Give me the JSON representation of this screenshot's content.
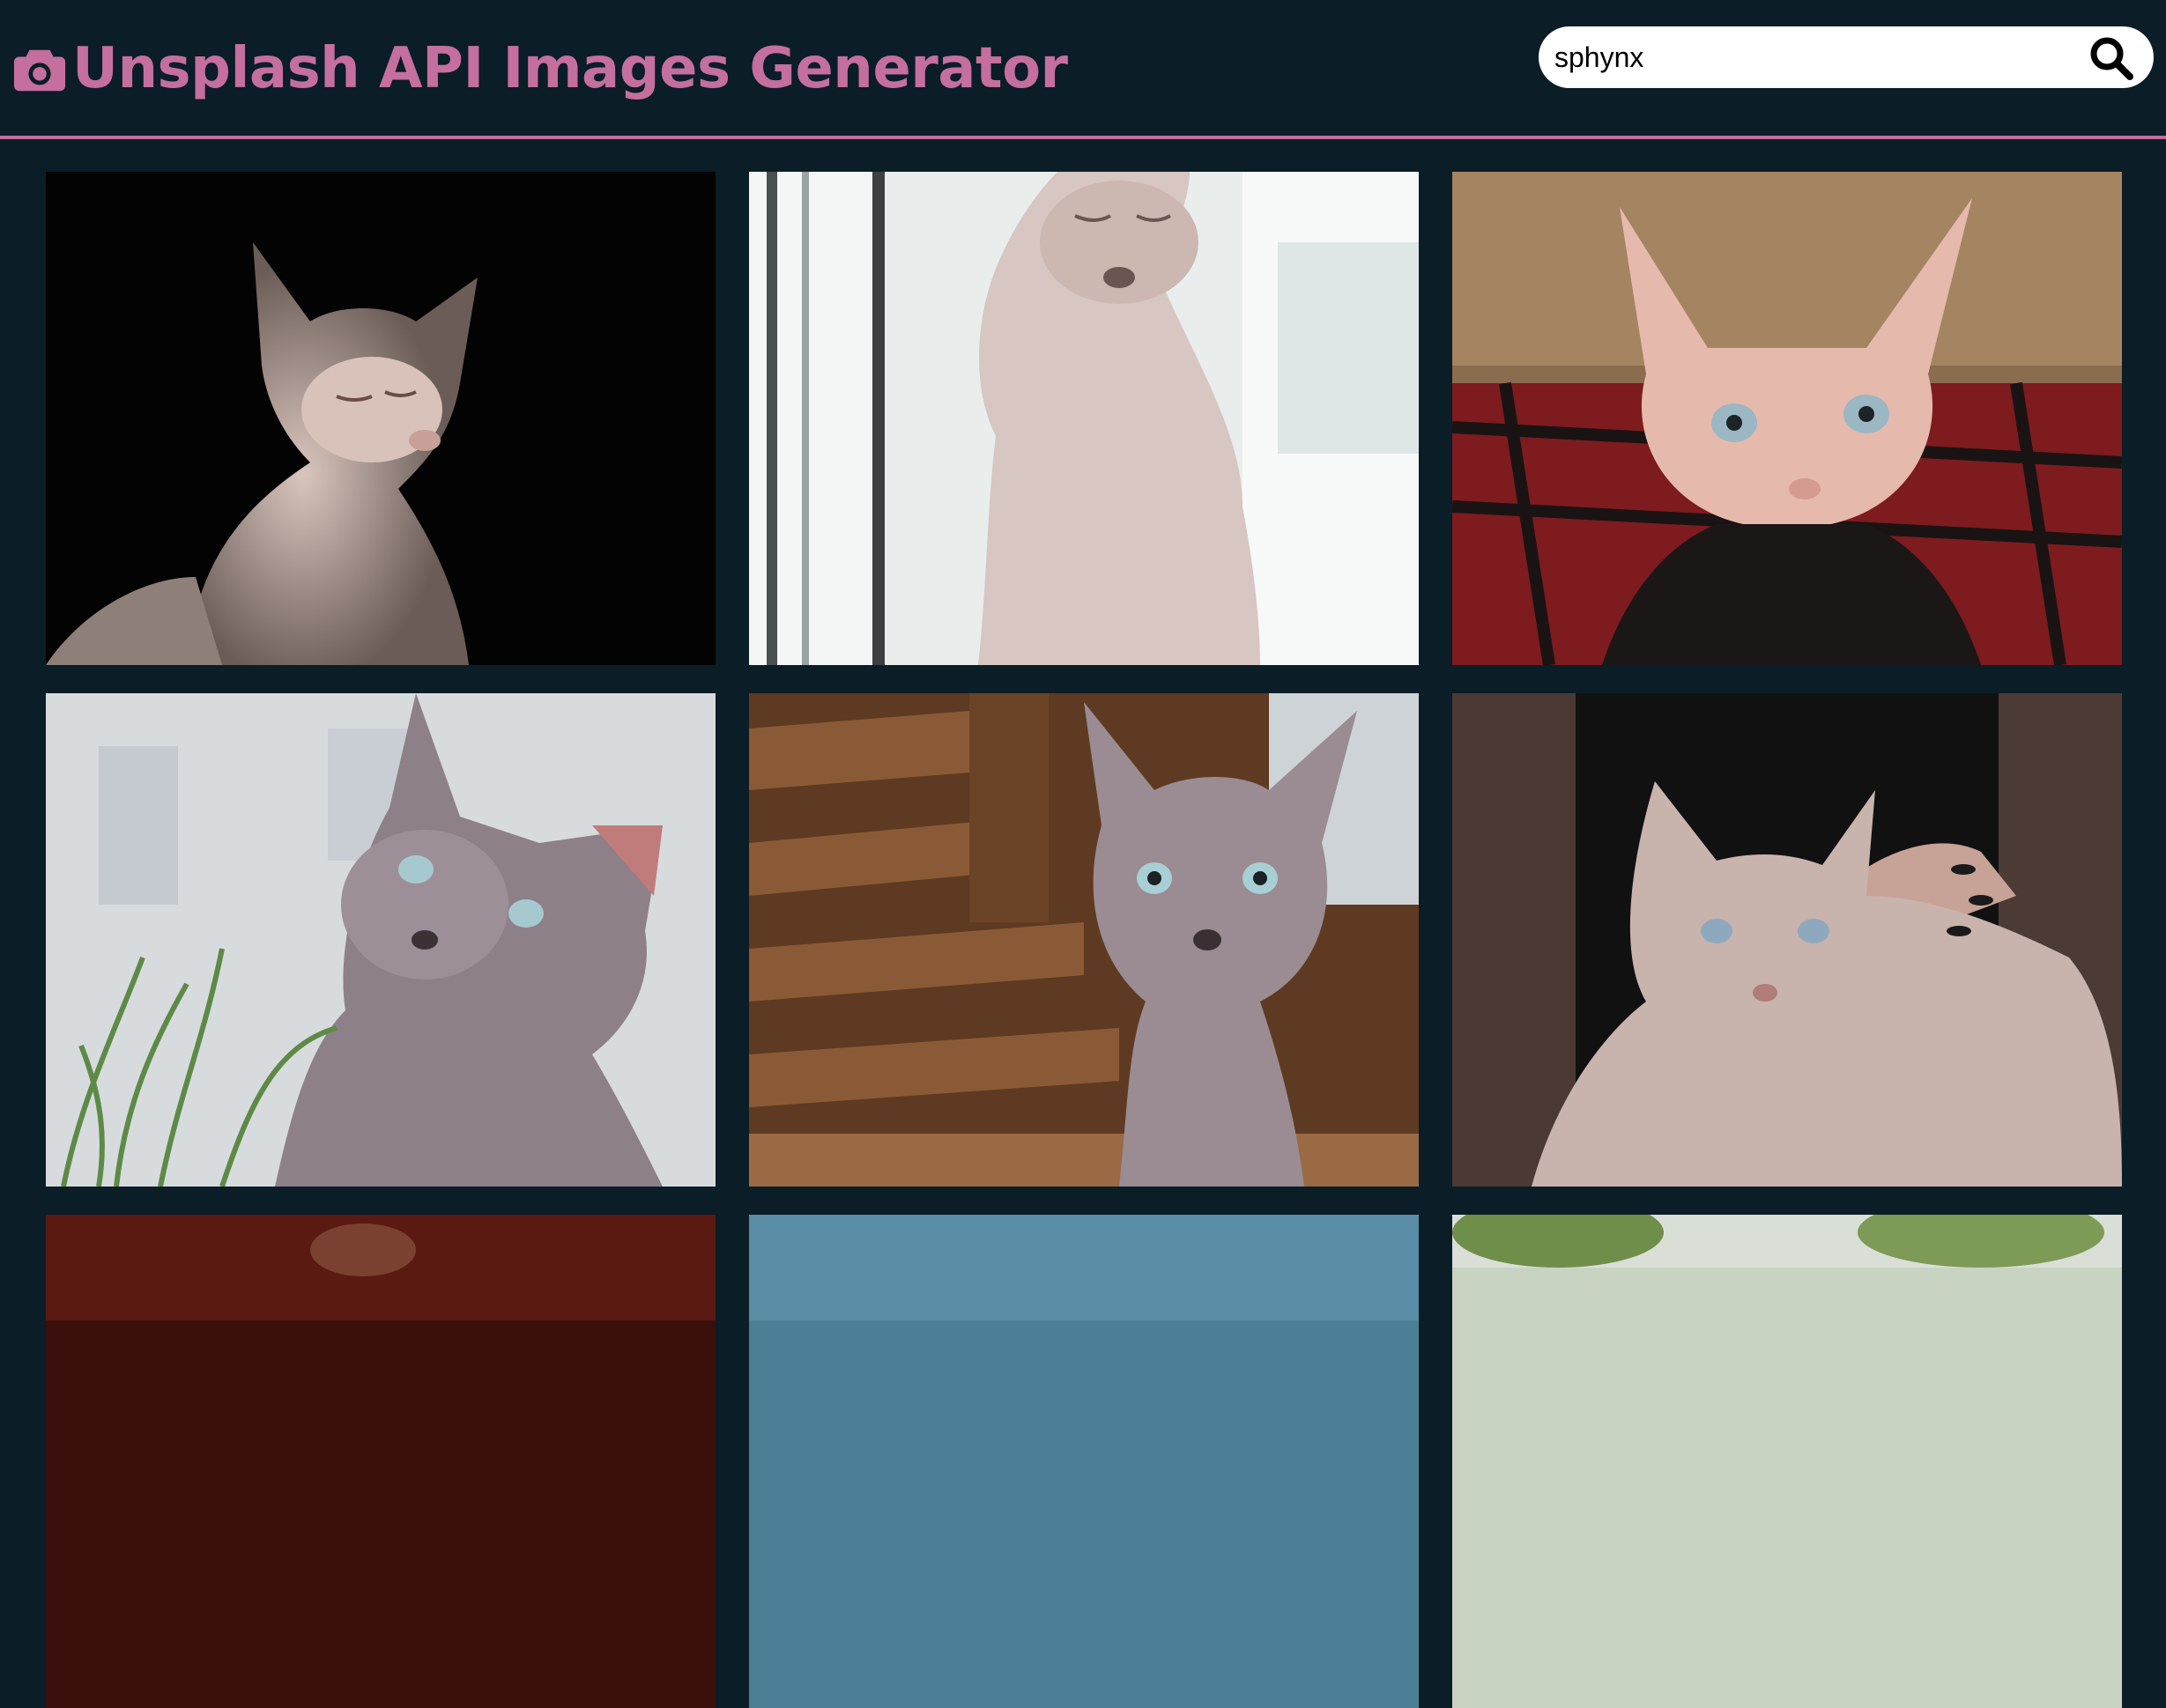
{
  "header": {
    "title": "Unsplash API Images Generator",
    "icon": "camera-icon",
    "accent_color": "#c46f9e",
    "background_color": "#0b1d26"
  },
  "search": {
    "value": "sphynx",
    "button_icon": "search-icon"
  },
  "gallery": {
    "images": [
      {
        "subject": "sphynx cat",
        "palette": "dark"
      },
      {
        "subject": "sphynx cat",
        "palette": "window-light"
      },
      {
        "subject": "sphynx cat",
        "palette": "red-plaid"
      },
      {
        "subject": "sphynx cat",
        "palette": "grass"
      },
      {
        "subject": "sphynx cat",
        "palette": "wood-bench"
      },
      {
        "subject": "sphynx cat",
        "palette": "tattooed-lap"
      },
      {
        "subject": "sphynx cat",
        "palette": "dark-red"
      },
      {
        "subject": "sphynx cat",
        "palette": "blue-sky"
      },
      {
        "subject": "sphynx cat",
        "palette": "green-outdoor"
      }
    ]
  }
}
